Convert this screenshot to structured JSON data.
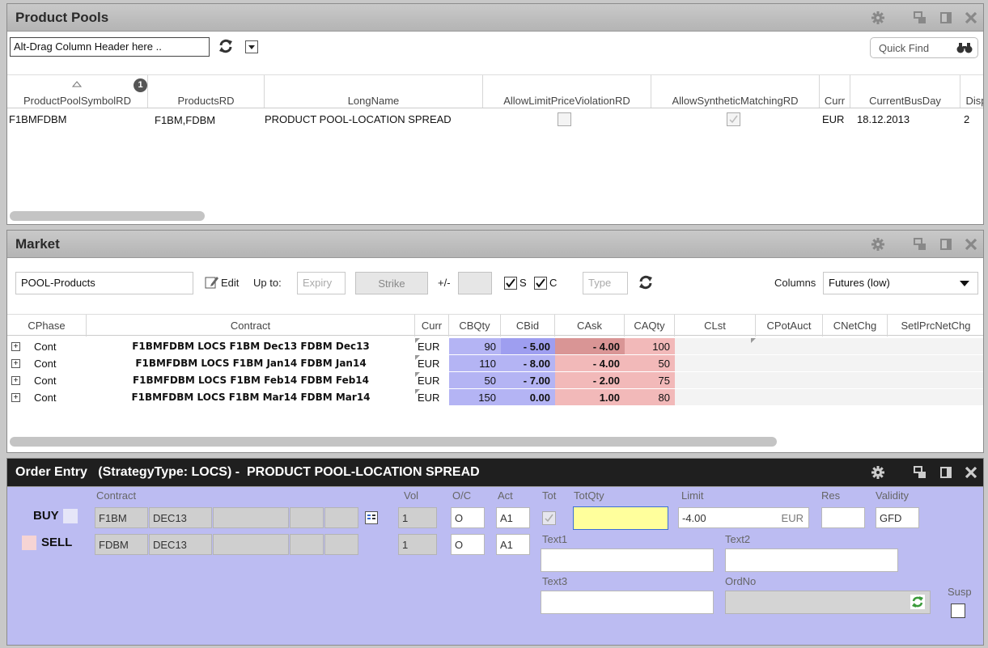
{
  "product_pools": {
    "title": "Product Pools",
    "group_placeholder": "Alt-Drag Column Header here ..",
    "quick_find": "Quick Find",
    "sort_badge": "1",
    "columns": [
      "ProductPoolSymbolRD",
      "ProductsRD",
      "LongName",
      "AllowLimitPriceViolationRD",
      "AllowSyntheticMatchingRD",
      "Curr",
      "CurrentBusDay",
      "Disp"
    ],
    "rows": [
      {
        "symbol": "F1BMFDBM",
        "products": "F1BM,FDBM",
        "long_name": "PRODUCT POOL-LOCATION SPREAD",
        "allow_limit": false,
        "allow_synthetic": true,
        "curr": "EUR",
        "bus_day": "18.12.2013",
        "disp": "2"
      }
    ]
  },
  "market": {
    "title": "Market",
    "pool": "POOL-Products",
    "edit": "Edit",
    "up_to": "Up to:",
    "expiry_ph": "Expiry",
    "strike": "Strike",
    "plus_minus": "+/-",
    "s_label": "S",
    "c_label": "C",
    "type_ph": "Type",
    "columns_label": "Columns",
    "columns_value": "Futures (low)",
    "headers": [
      "CPhase",
      "Contract",
      "Curr",
      "CBQty",
      "CBid",
      "CAsk",
      "CAQty",
      "CLst",
      "CPotAuct",
      "CNetChg",
      "SetlPrcNetChg"
    ],
    "rows": [
      {
        "phase": "Cont",
        "contract": "F1BMFDBM LOCS F1BM Dec13 FDBM Dec13",
        "curr": "EUR",
        "bqty": "90",
        "bid": "- 5.00",
        "ask": "- 4.00",
        "aqty": "100"
      },
      {
        "phase": "Cont",
        "contract": "F1BMFDBM LOCS F1BM Jan14 FDBM Jan14",
        "curr": "EUR",
        "bqty": "110",
        "bid": "- 8.00",
        "ask": "- 4.00",
        "aqty": "50"
      },
      {
        "phase": "Cont",
        "contract": "F1BMFDBM LOCS F1BM Feb14 FDBM Feb14",
        "curr": "EUR",
        "bqty": "50",
        "bid": "- 7.00",
        "ask": "- 2.00",
        "aqty": "75"
      },
      {
        "phase": "Cont",
        "contract": "F1BMFDBM LOCS F1BM Mar14 FDBM Mar14",
        "curr": "EUR",
        "bqty": "150",
        "bid": "0.00",
        "ask": "1.00",
        "aqty": "80"
      }
    ]
  },
  "order_entry": {
    "title": "Order Entry   (StrategyType: LOCS) -  PRODUCT POOL-LOCATION SPREAD",
    "labels": {
      "contract": "Contract",
      "vol": "Vol",
      "oc": "O/C",
      "act": "Act",
      "tot": "Tot",
      "totqty": "TotQty",
      "limit": "Limit",
      "res": "Res",
      "validity": "Validity",
      "text1": "Text1",
      "text2": "Text2",
      "text3": "Text3",
      "ordno": "OrdNo",
      "susp": "Susp"
    },
    "buy": {
      "label": "BUY",
      "product": "F1BM",
      "expiry": "DEC13",
      "vol": "1",
      "oc": "O",
      "act": "A1"
    },
    "sell": {
      "label": "SELL",
      "product": "FDBM",
      "expiry": "DEC13",
      "vol": "1",
      "oc": "O",
      "act": "A1"
    },
    "limit_value": "-4.00",
    "limit_curr": "EUR",
    "validity_value": "GFD"
  },
  "colors": {
    "bid_bg": "#b4b4f4",
    "bid_dark": "#9e9ef0",
    "ask_bg": "#f2b9b9",
    "ask_dark": "#d99595",
    "order_entry_bg": "#bcbcf2",
    "header_dark": "#1f1f1f"
  }
}
